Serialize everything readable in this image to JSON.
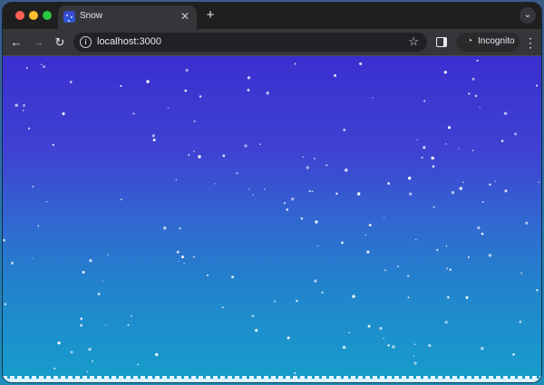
{
  "tab": {
    "title": "Snow",
    "favicon": "snow-favicon",
    "close_icon": "✕"
  },
  "tabstrip": {
    "new_tab_icon": "+",
    "tab_search_icon": "⌄"
  },
  "toolbar": {
    "back_icon": "←",
    "forward_icon": "→",
    "reload_icon": "↻",
    "info_icon": "i",
    "url": "localhost:3000",
    "bookmark_icon": "☆",
    "incognito_label": "Incognito",
    "incognito_icon": "◔",
    "menu_icon": "⋮"
  },
  "colors": {
    "sky_top": "#3a2fcf",
    "sky_bottom": "#169dcb",
    "snow": "#ffffff"
  }
}
